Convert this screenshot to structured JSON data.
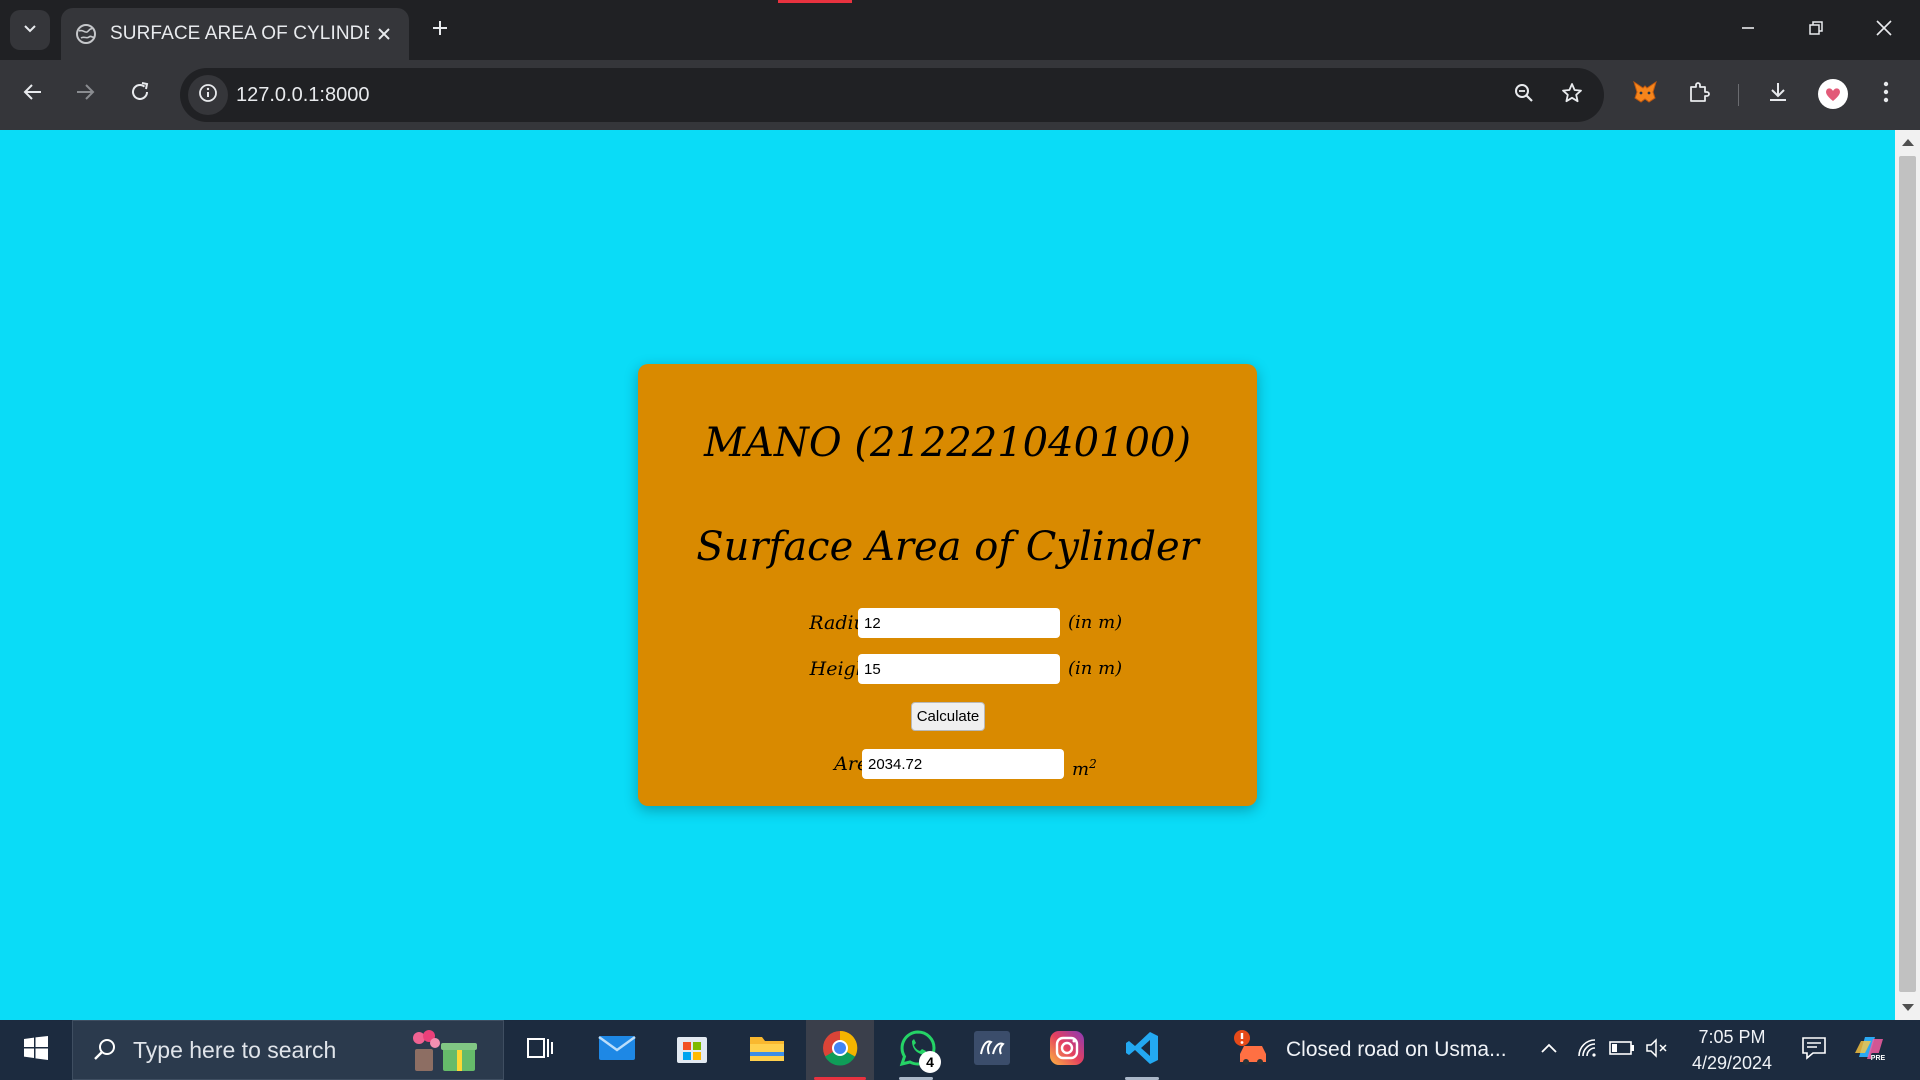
{
  "browser": {
    "tab_title": "SURFACE AREA OF CYLINDER",
    "url": "127.0.0.1:8000"
  },
  "page": {
    "student": "MANO (212221040100)",
    "heading": "Surface Area of Cylinder",
    "radius": {
      "label": "Radius :",
      "value": "12",
      "unit": "(in m)"
    },
    "height": {
      "label": "Height :",
      "value": "15",
      "unit": "(in m)"
    },
    "calculate_label": "Calculate",
    "area": {
      "label": "Area :",
      "value": "2034.72",
      "unit": "m",
      "unit_sup": "2"
    }
  },
  "taskbar": {
    "search_placeholder": "Type here to search",
    "whatsapp_badge": "4",
    "news_text": "Closed road on Usma...",
    "time": "7:05 PM",
    "date": "4/29/2024"
  },
  "colors": {
    "page_background": "#0adcf7",
    "card_background": "#d98a00",
    "browser_frame": "#202124",
    "taskbar": "#1c2b3f"
  },
  "icons": {
    "tab_search": "chevron-down-icon",
    "tab_favicon": "globe-icon",
    "tab_close": "close-icon",
    "new_tab": "plus-icon",
    "window": [
      "minimize-icon",
      "restore-icon",
      "close-icon"
    ],
    "nav": [
      "back-arrow-icon",
      "forward-arrow-icon",
      "reload-icon"
    ],
    "omnibox": [
      "info-icon",
      "zoom-icon",
      "star-icon"
    ],
    "extensions": [
      "metamask-fox-icon",
      "puzzle-icon",
      "download-icon",
      "profile-avatar-icon",
      "more-vertical-icon"
    ],
    "taskbar_apps": [
      "windows-start-icon",
      "task-view-icon",
      "mail-icon",
      "ms-store-icon",
      "file-explorer-icon",
      "chrome-icon",
      "whatsapp-icon",
      "video-editor-icon",
      "instagram-icon",
      "vscode-icon"
    ],
    "tray": [
      "chevron-up-icon",
      "wifi-icon",
      "battery-icon",
      "speaker-muted-icon",
      "notification-icon",
      "copilot-icon"
    ]
  }
}
